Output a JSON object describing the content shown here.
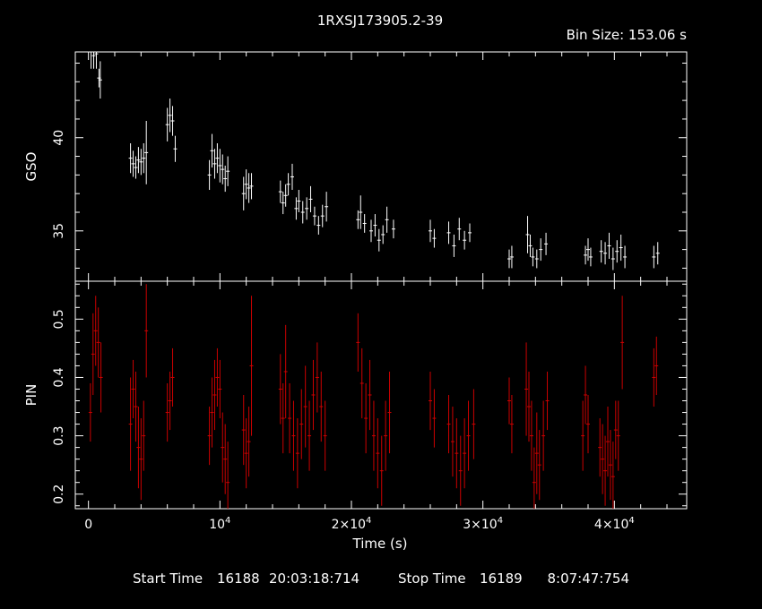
{
  "chart_data": [
    {
      "type": "scatter",
      "title": "1RXSJ173905.2-39",
      "subtitle": "Bin Size: 153.06 s",
      "ylabel": "GSO",
      "xlim": [
        -1000,
        45500
      ],
      "ylim": [
        32.3,
        44.6
      ],
      "yticks": [
        35,
        40
      ],
      "ytick_labels": [
        "35",
        "40"
      ],
      "grid": false,
      "color": "#ffffff",
      "series": [
        {
          "x": [
            200,
            400,
            600,
            800,
            900,
            3200,
            3400,
            3600,
            3800,
            4000,
            4200,
            4400,
            6000,
            6200,
            6400,
            6600,
            9200,
            9400,
            9600,
            9800,
            10000,
            10200,
            10400,
            10600,
            11800,
            12000,
            12200,
            12400,
            14600,
            14800,
            15000,
            15200,
            15500,
            15800,
            16000,
            16300,
            16600,
            16900,
            17200,
            17500,
            17800,
            18100,
            20500,
            20700,
            21000,
            21500,
            21800,
            22100,
            22400,
            22700,
            23200,
            26000,
            26300,
            27400,
            27800,
            28200,
            28600,
            29000,
            32000,
            32200,
            33400,
            33600,
            33800,
            34100,
            34400,
            34800,
            37800,
            38000,
            38200,
            39000,
            39300,
            39600,
            39900,
            40200,
            40500,
            40800,
            43000,
            43300
          ],
          "y": [
            44.6,
            44.4,
            44.5,
            43.2,
            43.1,
            38.9,
            38.6,
            38.4,
            38.8,
            38.7,
            38.9,
            39.2,
            40.7,
            41.2,
            40.9,
            39.4,
            38.0,
            39.3,
            38.6,
            38.9,
            38.5,
            38.3,
            37.8,
            38.2,
            37.0,
            37.5,
            37.3,
            37.4,
            37.1,
            36.5,
            36.9,
            37.5,
            37.9,
            36.2,
            36.6,
            36.0,
            36.2,
            36.7,
            35.8,
            35.3,
            35.8,
            36.3,
            35.6,
            36.0,
            35.4,
            35.0,
            35.3,
            34.5,
            34.8,
            35.6,
            35.1,
            35.0,
            34.6,
            34.9,
            34.2,
            35.1,
            34.5,
            34.9,
            33.5,
            33.6,
            34.8,
            34.2,
            33.6,
            33.5,
            34.0,
            34.3,
            33.7,
            34.0,
            33.6,
            33.9,
            33.8,
            34.2,
            33.5,
            33.9,
            34.1,
            33.6,
            33.6,
            33.8
          ],
          "err": [
            0.9,
            0.7,
            0.8,
            0.5,
            1.0,
            0.8,
            0.7,
            0.6,
            0.7,
            0.7,
            0.8,
            1.7,
            0.9,
            0.9,
            0.8,
            0.7,
            0.8,
            0.9,
            0.8,
            0.8,
            0.9,
            0.8,
            0.7,
            0.8,
            0.9,
            0.8,
            0.8,
            0.7,
            0.6,
            0.6,
            0.6,
            0.6,
            0.7,
            0.6,
            0.6,
            0.6,
            0.6,
            0.7,
            0.5,
            0.5,
            0.6,
            0.8,
            0.5,
            0.9,
            0.5,
            0.6,
            0.6,
            0.6,
            0.5,
            0.7,
            0.5,
            0.6,
            0.5,
            0.6,
            0.6,
            0.6,
            0.5,
            0.5,
            0.5,
            0.6,
            1.0,
            0.6,
            0.5,
            0.5,
            0.6,
            0.6,
            0.5,
            0.6,
            0.5,
            0.6,
            0.6,
            0.7,
            0.6,
            0.6,
            0.7,
            0.6,
            0.6,
            0.6
          ]
        }
      ]
    },
    {
      "type": "scatter",
      "ylabel": "PIN",
      "xlabel": "Time (s)",
      "xlim": [
        -1000,
        45500
      ],
      "ylim": [
        0.175,
        0.565
      ],
      "yticks": [
        0.2,
        0.3,
        0.4,
        0.5
      ],
      "ytick_labels": [
        "0.2",
        "0.3",
        "0.4",
        "0.5"
      ],
      "xticks": [
        0,
        10000,
        20000,
        30000,
        40000
      ],
      "xtick_labels": [
        {
          "base": "0",
          "exp": ""
        },
        {
          "base": "10",
          "exp": "4"
        },
        {
          "base": "2×10",
          "exp": "4"
        },
        {
          "base": "3×10",
          "exp": "4"
        },
        {
          "base": "4×10",
          "exp": "4"
        }
      ],
      "grid": false,
      "color": "#cc0000",
      "series": [
        {
          "x": [
            150,
            350,
            550,
            750,
            950,
            3200,
            3400,
            3600,
            3800,
            4000,
            4200,
            4400,
            6000,
            6200,
            6400,
            9200,
            9400,
            9600,
            9800,
            10000,
            10200,
            10400,
            10600,
            11800,
            12000,
            12200,
            12400,
            14600,
            14800,
            15000,
            15300,
            15600,
            15900,
            16200,
            16500,
            16800,
            17100,
            17400,
            17700,
            18000,
            20500,
            20800,
            21100,
            21400,
            21700,
            22000,
            22300,
            22600,
            22900,
            26000,
            26300,
            27400,
            27700,
            28000,
            28300,
            28600,
            28900,
            29300,
            32000,
            32200,
            33300,
            33500,
            33700,
            33900,
            34100,
            34300,
            34600,
            34900,
            37600,
            37800,
            38000,
            38900,
            39100,
            39300,
            39500,
            39700,
            39900,
            40100,
            40300,
            40600,
            43000,
            43200
          ],
          "y": [
            0.34,
            0.44,
            0.48,
            0.46,
            0.4,
            0.32,
            0.38,
            0.35,
            0.28,
            0.26,
            0.3,
            0.48,
            0.34,
            0.36,
            0.4,
            0.3,
            0.34,
            0.37,
            0.4,
            0.38,
            0.28,
            0.26,
            0.22,
            0.31,
            0.27,
            0.29,
            0.42,
            0.38,
            0.33,
            0.41,
            0.33,
            0.3,
            0.27,
            0.32,
            0.35,
            0.3,
            0.37,
            0.4,
            0.35,
            0.3,
            0.46,
            0.39,
            0.33,
            0.37,
            0.3,
            0.27,
            0.24,
            0.3,
            0.34,
            0.36,
            0.33,
            0.32,
            0.29,
            0.27,
            0.24,
            0.27,
            0.3,
            0.32,
            0.36,
            0.32,
            0.38,
            0.35,
            0.3,
            0.22,
            0.27,
            0.25,
            0.3,
            0.36,
            0.3,
            0.37,
            0.32,
            0.28,
            0.26,
            0.24,
            0.29,
            0.25,
            0.23,
            0.31,
            0.3,
            0.46,
            0.4,
            0.42
          ],
          "err": [
            0.05,
            0.07,
            0.06,
            0.06,
            0.06,
            0.08,
            0.05,
            0.06,
            0.07,
            0.07,
            0.06,
            0.08,
            0.05,
            0.05,
            0.05,
            0.05,
            0.06,
            0.06,
            0.05,
            0.05,
            0.06,
            0.06,
            0.07,
            0.06,
            0.06,
            0.06,
            0.12,
            0.06,
            0.06,
            0.08,
            0.06,
            0.06,
            0.06,
            0.06,
            0.07,
            0.06,
            0.06,
            0.06,
            0.06,
            0.06,
            0.05,
            0.06,
            0.06,
            0.06,
            0.06,
            0.06,
            0.06,
            0.06,
            0.07,
            0.05,
            0.05,
            0.05,
            0.06,
            0.06,
            0.06,
            0.06,
            0.06,
            0.06,
            0.04,
            0.05,
            0.08,
            0.06,
            0.06,
            0.06,
            0.07,
            0.06,
            0.06,
            0.05,
            0.06,
            0.05,
            0.05,
            0.05,
            0.06,
            0.06,
            0.06,
            0.06,
            0.06,
            0.05,
            0.06,
            0.08,
            0.05,
            0.05
          ]
        }
      ]
    }
  ],
  "footer": {
    "start_label": "Start Time",
    "start_day": "16188",
    "start_time": "20:03:18:714",
    "stop_label": "Stop Time",
    "stop_day": "16189",
    "stop_time": "8:07:47:754"
  }
}
